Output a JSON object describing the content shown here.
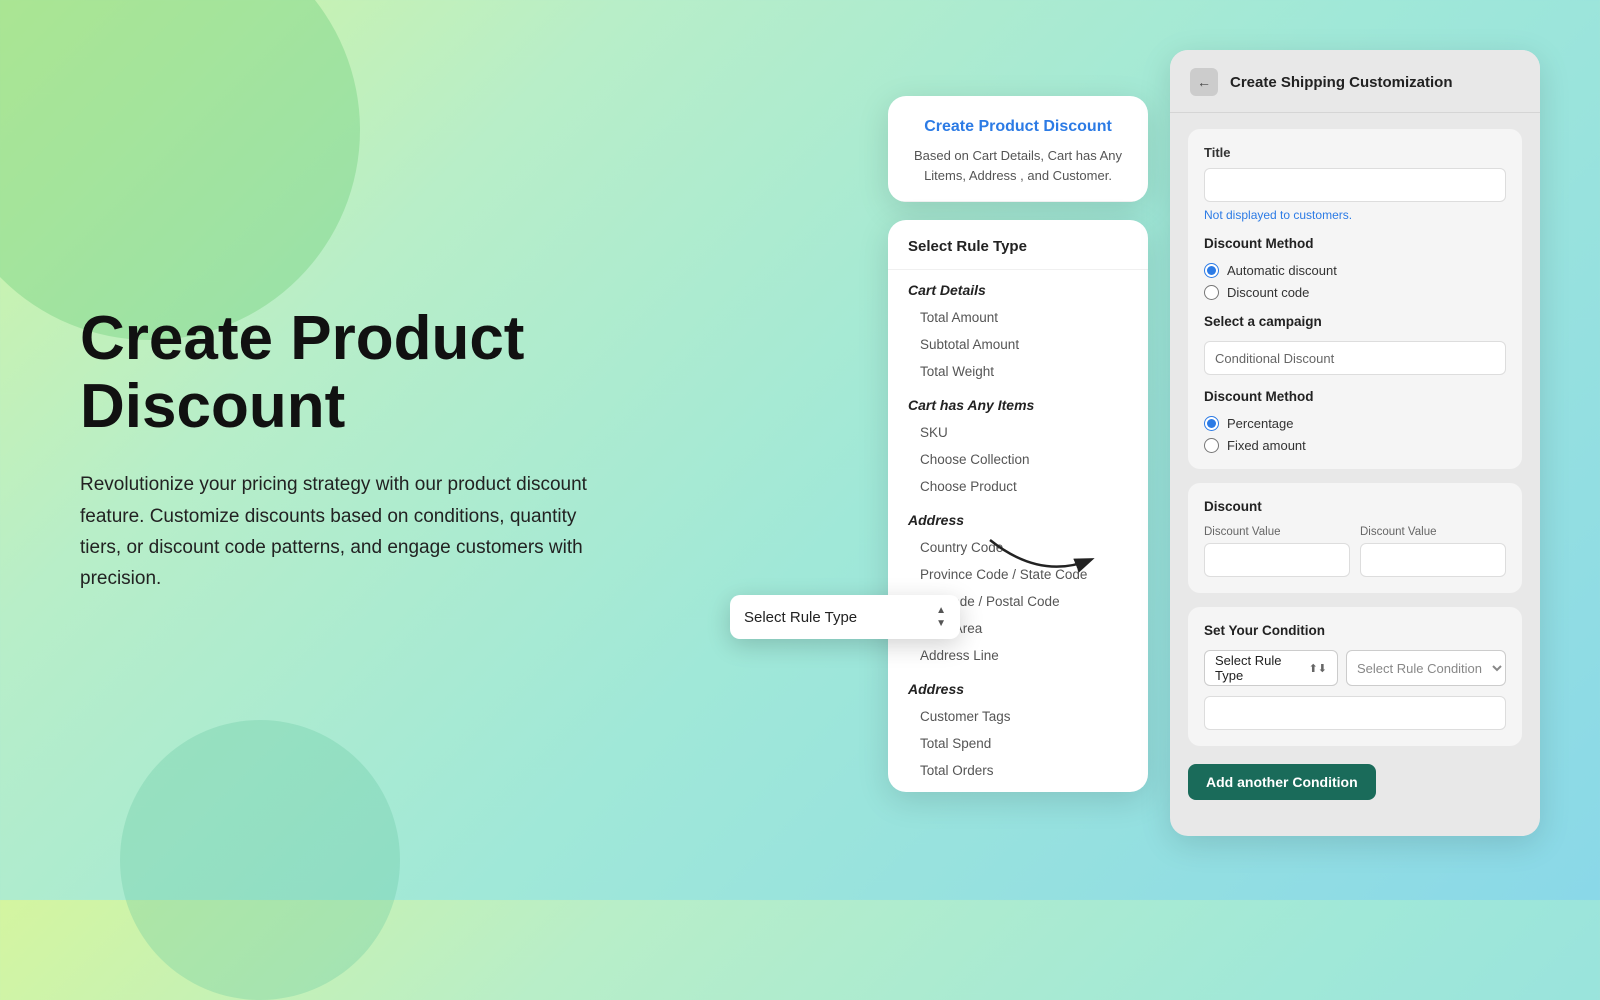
{
  "background": {
    "gradient": "linear-gradient(135deg, #d4f5a0 0%, #b8eec8 25%, #a0e8d8 55%, #8ad8e8 100%)"
  },
  "hero": {
    "title": "Create Product Discount",
    "description": "Revolutionize your pricing strategy with our product discount feature. Customize discounts based on conditions, quantity tiers, or discount code patterns, and engage customers with precision."
  },
  "product_card": {
    "title": "Create Product Discount",
    "description": "Based on Cart Details, Cart has Any Litems, Address , and Customer."
  },
  "rule_type_card": {
    "header": "Select Rule Type",
    "groups": [
      {
        "title": "Cart Details",
        "items": [
          "Total Amount",
          "Subtotal Amount",
          "Total Weight"
        ]
      },
      {
        "title": "Cart has Any Items",
        "items": [
          "SKU",
          "Choose Collection",
          "Choose Product"
        ]
      },
      {
        "title": "Address",
        "items": [
          "Country Code",
          "Province Code / State Code",
          "Zip Code / Postal Code",
          "City / Area",
          "Address Line"
        ]
      },
      {
        "title": "Address",
        "items": [
          "Customer Tags",
          "Total Spend",
          "Total Orders"
        ]
      }
    ]
  },
  "shipping_card": {
    "header": "Create Shipping Customization",
    "back_button": "←",
    "title_label": "Title",
    "title_placeholder": "",
    "not_displayed_text": "Not displayed to customers.",
    "discount_method_label": "Discount Method",
    "discount_method_options": [
      {
        "label": "Automatic discount",
        "value": "automatic",
        "checked": true
      },
      {
        "label": "Discount code",
        "value": "code",
        "checked": false
      }
    ],
    "select_campaign_label": "Select a campaign",
    "campaign_value": "Conditional Discount",
    "discount_method2_label": "Discount Method",
    "discount_method2_options": [
      {
        "label": "Percentage",
        "value": "percentage",
        "checked": true
      },
      {
        "label": "Fixed amount",
        "value": "fixed",
        "checked": false
      }
    ],
    "discount_section_label": "Discount",
    "discount_value1_label": "Discount Value",
    "discount_value2_label": "Discount Value",
    "condition_section_label": "Set Your Condition",
    "select_rule_type_label": "Select Rule Type",
    "select_rule_condition_label": "Select Rule Condition",
    "add_condition_btn": "Add another Condition"
  },
  "floating_dropdown": {
    "label": "Select Rule Type",
    "arrow_up": "▲",
    "arrow_down": "▼"
  }
}
